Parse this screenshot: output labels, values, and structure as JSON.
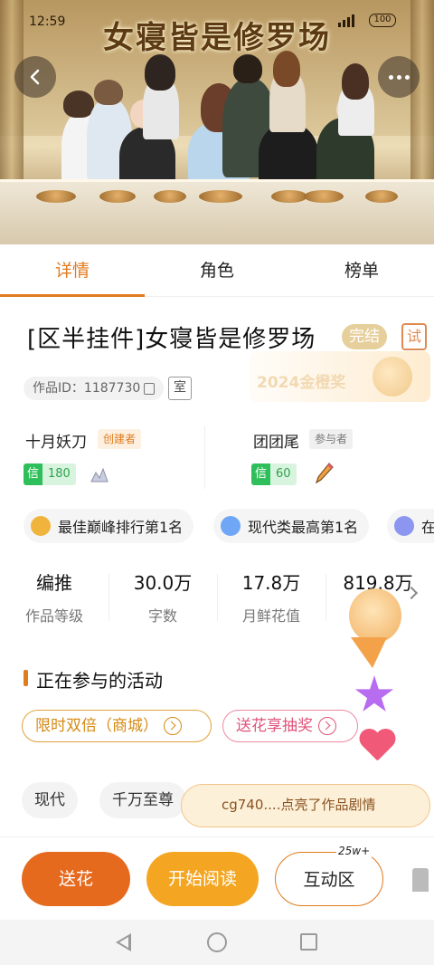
{
  "status_bar": {
    "time": "12:59",
    "battery": "100"
  },
  "banner": {
    "art_title": "女寝皆是修罗场"
  },
  "tabs": [
    {
      "label": "详情",
      "active": true
    },
    {
      "label": "角色",
      "active": false
    },
    {
      "label": "榜单",
      "active": false
    }
  ],
  "work": {
    "title": "[区半挂件]女寝皆是修罗场",
    "status_badge": "完结",
    "trial_badge": "试",
    "id_label": "作品ID：1187730",
    "room_label": "室",
    "award_text": "2024金橙奖"
  },
  "authors": [
    {
      "name": "十月妖刀",
      "role": "创建者",
      "credit_label": "信",
      "credit_value": "180"
    },
    {
      "name": "团团尾",
      "role": "参与者",
      "credit_label": "信",
      "credit_value": "60"
    }
  ],
  "honors": [
    {
      "text": "最佳巅峰排行第1名",
      "icon_color": "#f0b43c"
    },
    {
      "text": "现代类最高第1名",
      "icon_color": "#6fa6f5"
    },
    {
      "text": "在",
      "icon_color": "#8c96f0"
    }
  ],
  "stats": [
    {
      "value": "编推",
      "label": "作品等级"
    },
    {
      "value": "30.0万",
      "label": "字数"
    },
    {
      "value": "17.8万",
      "label": "月鲜花值"
    },
    {
      "value": "819.8万",
      "label": ""
    }
  ],
  "activities": {
    "title": "正在参与的活动",
    "items": [
      {
        "label": "限时双倍（商城）"
      },
      {
        "label": "送花享抽奖"
      }
    ]
  },
  "tags": [
    "现代",
    "千万至尊"
  ],
  "notification": "cg740....点亮了作品剧情",
  "bottom_bar": {
    "gift_label": "送花",
    "read_label": "开始阅读",
    "interact_label": "互动区",
    "interact_count": "25w+"
  },
  "colors": {
    "accent": "#e07b1f",
    "gift": "#e66a1e",
    "read": "#f4a623",
    "credit": "#2fbf5a"
  }
}
